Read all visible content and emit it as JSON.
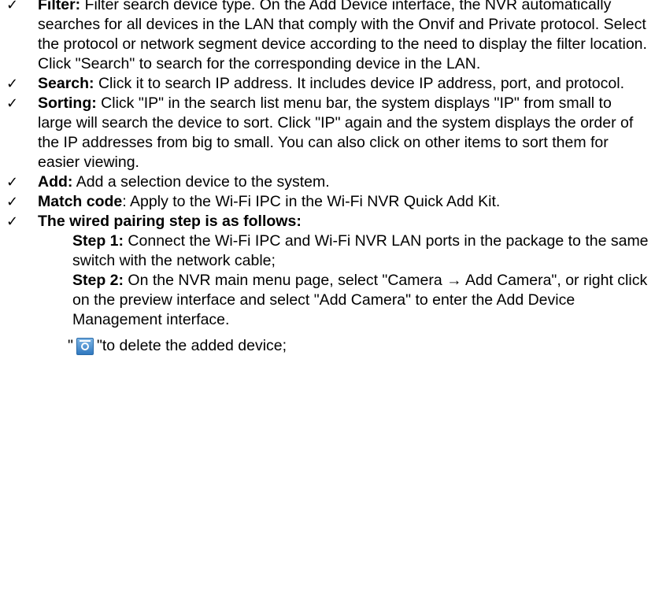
{
  "filter": {
    "label": "Filter:",
    "text": " Filter search device type. On the Add Device interface, the NVR automatically searches for all devices in the LAN that comply with the Onvif and Private protocol. Select the protocol or network segment device according to the need to display the filter location. Click \"Search\" to search for the corresponding device in the LAN."
  },
  "search": {
    "label": "Search:",
    "text": " Click it to search IP address. It includes device IP address, port, and protocol."
  },
  "sorting": {
    "label": "Sorting:",
    "text": " Click \"IP\" in the search list menu bar, the system displays \"IP\" from small to large will search the device to sort. Click \"IP\" again and the system displays the order of the IP addresses from big to small. You can also click on other items to sort them for easier viewing."
  },
  "add": {
    "label": "Add:",
    "text": " Add a selection device to the system."
  },
  "match_code": {
    "label": "Match code",
    "colon": ":",
    "text": " Apply to the Wi-Fi IPC in the Wi-Fi NVR Quick Add Kit."
  },
  "wired_pairing": {
    "heading": "The wired pairing step is as follows:",
    "step1_label": "Step 1:",
    "step1_text": " Connect the Wi-Fi IPC and Wi-Fi NVR LAN ports in the package to the same switch with the network cable;",
    "step2_label": "Step 2:",
    "step2_text": " On the NVR main menu page, select \"Camera → Add Camera\", or right click on the preview interface and select \"Add Camera\" to enter the Add Device Management interface."
  },
  "delete_note": {
    "open_quote": "\"",
    "close_quote": "\"",
    "text": " to delete the added device;",
    "icon": "trash-icon"
  },
  "bullet_glyph": "✓"
}
